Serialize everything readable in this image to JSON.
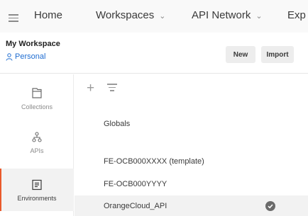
{
  "nav": {
    "home": "Home",
    "workspaces": "Workspaces",
    "api_network": "API Network",
    "explore": "Exp"
  },
  "workspace": {
    "name": "My Workspace",
    "visibility": "Personal",
    "new_label": "New",
    "import_label": "Import"
  },
  "sidebar": {
    "items": [
      {
        "label": "Collections",
        "icon": "collections-icon"
      },
      {
        "label": "APIs",
        "icon": "apis-icon"
      },
      {
        "label": "Environments",
        "icon": "environments-icon",
        "active": true
      }
    ]
  },
  "environments": {
    "globals": "Globals",
    "items": [
      {
        "name": "FE-OCB000XXXX (template)"
      },
      {
        "name": "FE-OCB000YYYY"
      },
      {
        "name": "OrangeCloud_API",
        "active": true
      }
    ]
  },
  "colors": {
    "accent": "#e9592b",
    "link": "#1f6dd1"
  }
}
